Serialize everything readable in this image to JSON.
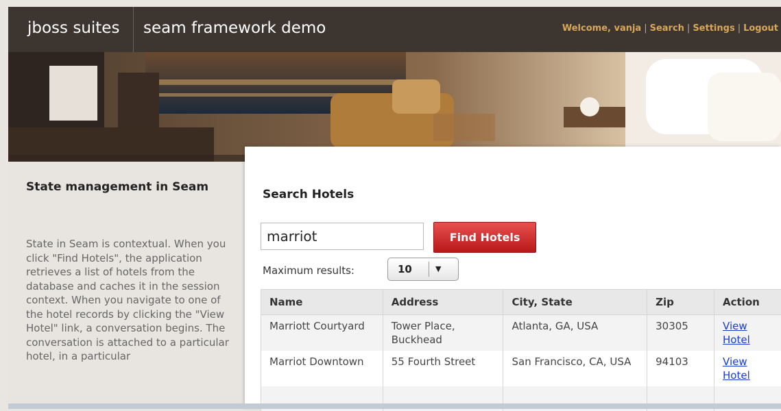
{
  "header": {
    "brand": "jboss suites",
    "app_title": "seam framework demo",
    "welcome": "Welcome, vanja",
    "nav": [
      "Search",
      "Settings",
      "Logout"
    ]
  },
  "sidebar": {
    "title": "State management in Seam",
    "text": "State in Seam is contextual. When you click \"Find Hotels\", the application retrieves a list of hotels from the database and caches it in the session context. When you navigate to one of the hotel records by clicking the \"View Hotel\" link, a conversation  begins. The conversation is attached to a particular hotel, in a particular"
  },
  "search": {
    "title": "Search Hotels",
    "query": "marriot",
    "button": "Find Hotels",
    "max_label": "Maximum results:",
    "max_value": "10"
  },
  "table": {
    "headers": [
      "Name",
      "Address",
      "City, State",
      "Zip",
      "Action"
    ],
    "rows": [
      {
        "name": "Marriott Courtyard",
        "address": "Tower Place, Buckhead",
        "city": "Atlanta, GA, USA",
        "zip": "30305",
        "action": "View Hotel"
      },
      {
        "name": "Marriot Downtown",
        "address": "55 Fourth Street",
        "city": "San Francisco, CA, USA",
        "zip": "94103",
        "action": "View Hotel"
      }
    ]
  },
  "colors": {
    "header_bg": "#3d3530",
    "nav_text": "#f0c070",
    "button_red": "#d03030",
    "link_blue": "#1a3ad8"
  }
}
